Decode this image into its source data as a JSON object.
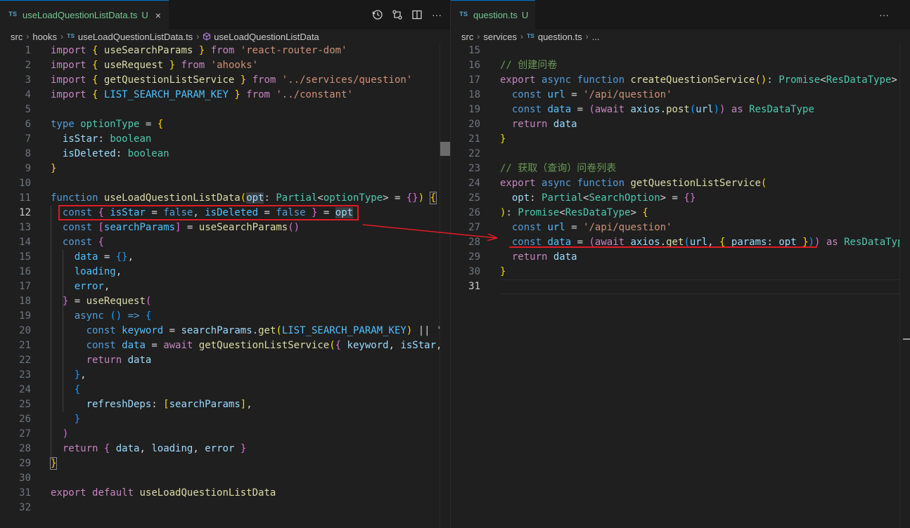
{
  "left": {
    "tab": {
      "badge": "TS",
      "name": "useLoadQuestionListData.ts",
      "status": "U",
      "close": "×"
    },
    "breadcrumb": [
      "src",
      "hooks",
      "useLoadQuestionListData.ts",
      "useLoadQuestionListData"
    ],
    "breadcrumb_ts": "TS",
    "actions_more": "···",
    "lines": [
      {
        "n": "1",
        "html": "<span class='k'>import</span> <span class='b1'>{</span> <span class='f'>useSearchParams</span> <span class='b1'>}</span> <span class='k'>from</span> <span class='s'>'react-router-dom'</span>"
      },
      {
        "n": "2",
        "html": "<span class='k'>import</span> <span class='b1'>{</span> <span class='f'>useRequest</span> <span class='b1'>}</span> <span class='k'>from</span> <span class='s'>'ahooks'</span>"
      },
      {
        "n": "3",
        "html": "<span class='k'>import</span> <span class='b1'>{</span> <span class='f'>getQuestionListService</span> <span class='b1'>}</span> <span class='k'>from</span> <span class='s'>'../services/question'</span>"
      },
      {
        "n": "4",
        "html": "<span class='k'>import</span> <span class='b1'>{</span> <span class='cn'>LIST_SEARCH_PARAM_KEY</span> <span class='b1'>}</span> <span class='k'>from</span> <span class='s'>'../constant'</span>"
      },
      {
        "n": "5",
        "html": ""
      },
      {
        "n": "6",
        "html": "<span class='kw'>type</span> <span class='t'>optionType</span> <span class='p'>=</span> <span class='b1'>{</span>"
      },
      {
        "n": "7",
        "html": "  <span class='v'>isStar</span><span class='p'>:</span> <span class='t'>boolean</span>"
      },
      {
        "n": "8",
        "html": "  <span class='v'>isDeleted</span><span class='p'>:</span> <span class='t'>boolean</span>"
      },
      {
        "n": "9",
        "html": "<span class='b1'>}</span>"
      },
      {
        "n": "10",
        "html": ""
      },
      {
        "n": "11",
        "html": "<span class='kw'>function</span> <span class='f'>useLoadQuestionListData</span><span class='b1'>(</span><span class='v hl'>opt</span><span class='p'>:</span> <span class='t'>Partial</span><span class='p'>&lt;</span><span class='t'>optionType</span><span class='p'>&gt;</span> <span class='p'>=</span> <span class='b2'>{}</span><span class='b1'>)</span> <span class='b1' style='outline:1px solid #888'>{</span>"
      },
      {
        "n": "12",
        "html": "  <span class='kw'>const</span> <span class='b2'>{</span> <span class='cn'>isStar</span> <span class='p'>=</span> <span class='kw'>false</span><span class='p'>,</span> <span class='cn'>isDeleted</span> <span class='p'>=</span> <span class='kw'>false</span> <span class='b2'>}</span> <span class='p'>=</span> <span class='v hl'>opt</span>"
      },
      {
        "n": "13",
        "html": "  <span class='kw'>const</span> <span class='b2'>[</span><span class='cn'>searchParams</span><span class='b2'>]</span> <span class='p'>=</span> <span class='f'>useSearchParams</span><span class='b2'>()</span>"
      },
      {
        "n": "14",
        "html": "  <span class='kw'>const</span> <span class='b2'>{</span>"
      },
      {
        "n": "15",
        "html": "    <span class='cn'>data</span> <span class='p'>=</span> <span class='b3'>{}</span><span class='p'>,</span>"
      },
      {
        "n": "16",
        "html": "    <span class='cn'>loading</span><span class='p'>,</span>"
      },
      {
        "n": "17",
        "html": "    <span class='cn'>error</span><span class='p'>,</span>"
      },
      {
        "n": "18",
        "html": "  <span class='b2'>}</span> <span class='p'>=</span> <span class='f'>useRequest</span><span class='b2'>(</span>"
      },
      {
        "n": "19",
        "html": "    <span class='kw'>async</span> <span class='b3'>()</span> <span class='kw'>=&gt;</span> <span class='b3'>{</span>"
      },
      {
        "n": "20",
        "html": "      <span class='kw'>const</span> <span class='cn'>keyword</span> <span class='p'>=</span> <span class='v'>searchParams</span><span class='p'>.</span><span class='f'>get</span><span class='b1'>(</span><span class='cn'>LIST_SEARCH_PARAM_KEY</span><span class='b1'>)</span> <span class='p'>||</span> <span class='s'>''</span>"
      },
      {
        "n": "21",
        "html": "      <span class='kw'>const</span> <span class='cn'>data</span> <span class='p'>=</span> <span class='k'>await</span> <span class='f'>getQuestionListService</span><span class='b1'>(</span><span class='b2'>{</span> <span class='v'>keyword</span><span class='p'>,</span> <span class='v'>isStar</span><span class='p'>,</span> <span class='v'>i</span>"
      },
      {
        "n": "22",
        "html": "      <span class='k'>return</span> <span class='v'>data</span>"
      },
      {
        "n": "23",
        "html": "    <span class='b3'>}</span><span class='p'>,</span>"
      },
      {
        "n": "24",
        "html": "    <span class='b3'>{</span>"
      },
      {
        "n": "25",
        "html": "      <span class='v'>refreshDeps</span><span class='p'>:</span> <span class='b1'>[</span><span class='v'>searchParams</span><span class='b1'>]</span><span class='p'>,</span>"
      },
      {
        "n": "26",
        "html": "    <span class='b3'>}</span>"
      },
      {
        "n": "27",
        "html": "  <span class='b2'>)</span>"
      },
      {
        "n": "28",
        "html": "  <span class='k'>return</span> <span class='b2'>{</span> <span class='v'>data</span><span class='p'>,</span> <span class='v'>loading</span><span class='p'>,</span> <span class='v'>error</span> <span class='b2'>}</span>"
      },
      {
        "n": "29",
        "html": "<span class='b1' style='outline:1px solid #888'>}</span>"
      },
      {
        "n": "30",
        "html": ""
      },
      {
        "n": "31",
        "html": "<span class='k'>export</span> <span class='k'>default</span> <span class='f'>useLoadQuestionListData</span>"
      },
      {
        "n": "32",
        "html": ""
      }
    ]
  },
  "right": {
    "tab": {
      "badge": "TS",
      "name": "question.ts",
      "status": "U"
    },
    "breadcrumb": [
      "src",
      "services",
      "question.ts",
      "..."
    ],
    "breadcrumb_ts": "TS",
    "actions_more": "···",
    "lines": [
      {
        "n": "15",
        "html": ""
      },
      {
        "n": "16",
        "html": "<span class='c'>// 创建问卷</span>"
      },
      {
        "n": "17",
        "html": "<span class='k'>export</span> <span class='kw'>async</span> <span class='kw'>function</span> <span class='f'>createQuestionService</span><span class='b1'>()</span><span class='p'>:</span> <span class='t'>Promise</span><span class='p'>&lt;</span><span class='t'>ResDataType</span><span class='p'>&gt;</span>"
      },
      {
        "n": "18",
        "html": "  <span class='kw'>const</span> <span class='cn'>url</span> <span class='p'>=</span> <span class='s'>'/api/question'</span>"
      },
      {
        "n": "19",
        "html": "  <span class='kw'>const</span> <span class='cn'>data</span> <span class='p'>=</span> <span class='b2'>(</span><span class='k'>await</span> <span class='v'>axios</span><span class='p'>.</span><span class='f'>post</span><span class='b3'>(</span><span class='v'>url</span><span class='b3'>)</span><span class='b2'>)</span> <span class='k'>as</span> <span class='t'>ResDataType</span>"
      },
      {
        "n": "20",
        "html": "  <span class='k'>return</span> <span class='v'>data</span>"
      },
      {
        "n": "21",
        "html": "<span class='b1'>}</span>"
      },
      {
        "n": "22",
        "html": ""
      },
      {
        "n": "23",
        "html": "<span class='c'>// 获取（查询）问卷列表</span>"
      },
      {
        "n": "24",
        "html": "<span class='k'>export</span> <span class='kw'>async</span> <span class='kw'>function</span> <span class='f'>getQuestionListService</span><span class='b1'>(</span>"
      },
      {
        "n": "25",
        "html": "  <span class='v'>opt</span><span class='p'>:</span> <span class='t'>Partial</span><span class='p'>&lt;</span><span class='t'>SearchOption</span><span class='p'>&gt;</span> <span class='p'>=</span> <span class='b2'>{}</span>"
      },
      {
        "n": "26",
        "html": "<span class='b1'>)</span><span class='p'>:</span> <span class='t'>Promise</span><span class='p'>&lt;</span><span class='t'>ResDataType</span><span class='p'>&gt;</span> <span class='b1'>{</span>"
      },
      {
        "n": "27",
        "html": "  <span class='kw'>const</span> <span class='cn'>url</span> <span class='p'>=</span> <span class='s'>'/api/question'</span>"
      },
      {
        "n": "28",
        "html": "  <span class='kw'>const</span> <span class='cn'>data</span> <span class='p'>=</span> <span class='b2'>(</span><span class='k'>await</span> <span class='v'>axios</span><span class='p'>.</span><span class='f'>get</span><span class='b3'>(</span><span class='v'>url</span><span class='p'>,</span> <span class='b1'>{</span> <span class='v'>params</span><span class='p'>:</span> <span class='v'>opt</span> <span class='b1'>}</span><span class='b3'>)</span><span class='b2'>)</span> <span class='k'>as</span> <span class='t'>ResDataTyp</span>"
      },
      {
        "n": "29",
        "html": "  <span class='k'>return</span> <span class='v'>data</span>"
      },
      {
        "n": "30",
        "html": "<span class='b1'>}</span>"
      },
      {
        "n": "31",
        "html": ""
      }
    ]
  }
}
